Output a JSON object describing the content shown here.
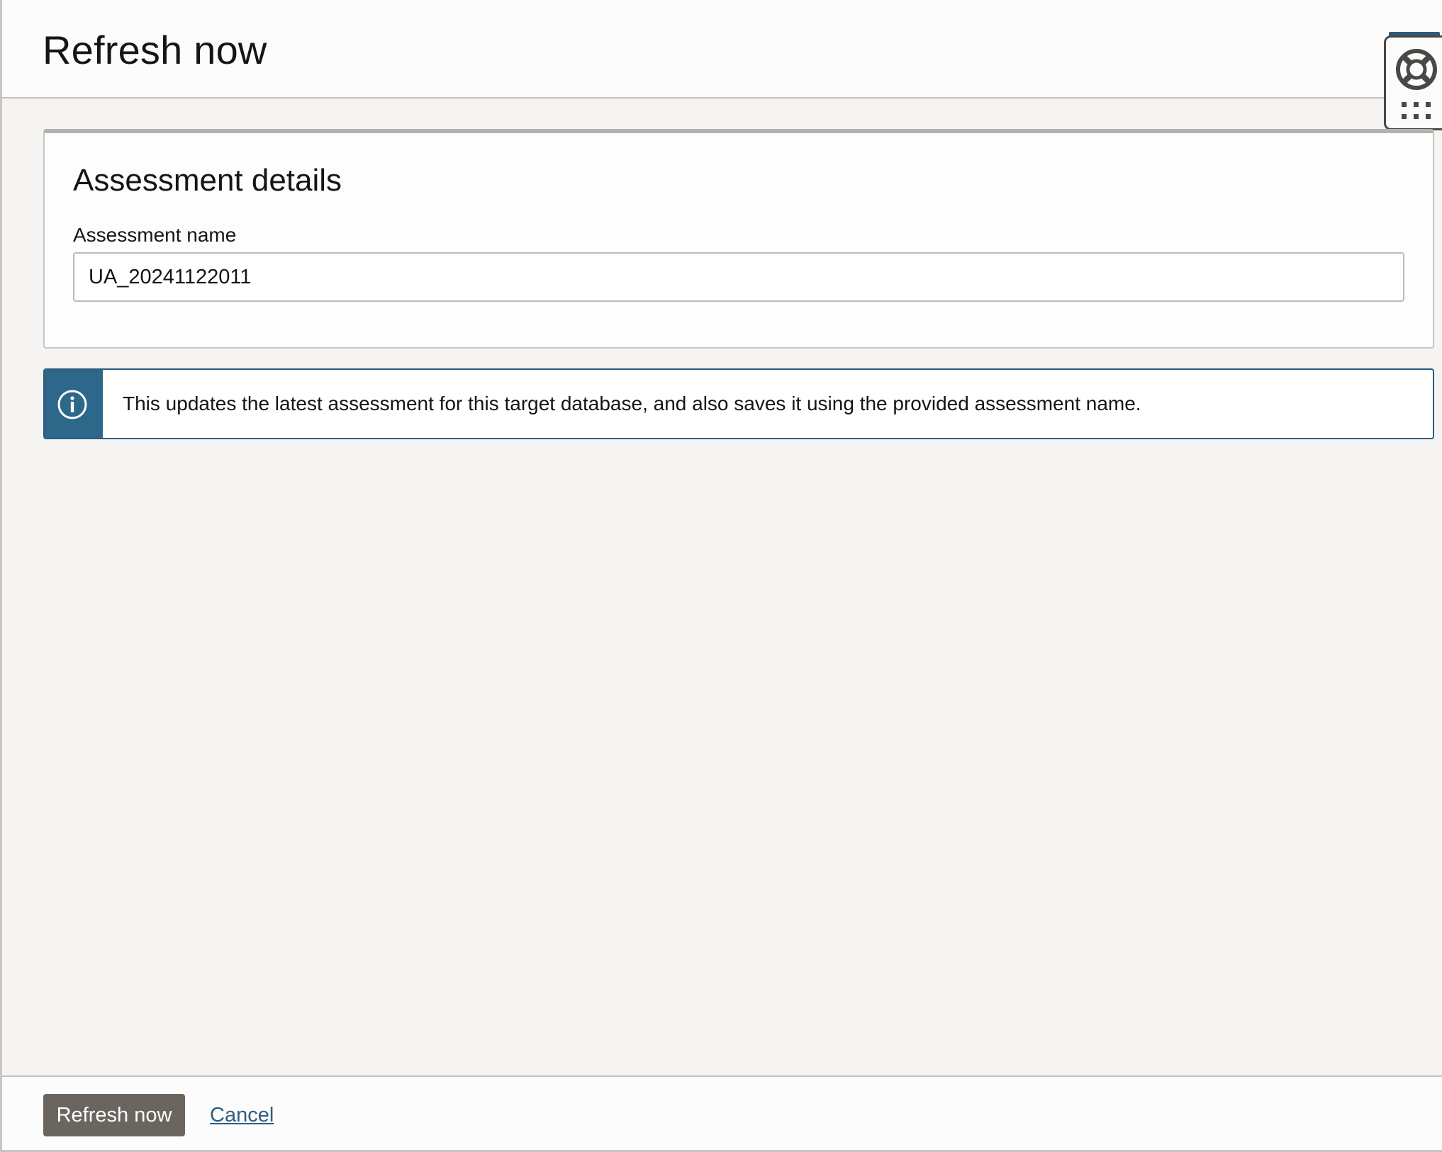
{
  "header": {
    "title": "Refresh now"
  },
  "helper": {
    "icons": [
      "lifebuoy-icon",
      "grid-icon"
    ]
  },
  "card": {
    "title": "Assessment details",
    "field": {
      "label": "Assessment name",
      "value": "UA_20241122011",
      "placeholder": ""
    }
  },
  "info": {
    "icon": "info-icon",
    "message": "This updates the latest assessment for this target database, and also saves it using the provided assessment name."
  },
  "footer": {
    "primary_label": "Refresh now",
    "cancel_label": "Cancel"
  },
  "colors": {
    "info_accent": "#2d6789",
    "primary_button": "#6b6560",
    "link": "#2e5e80"
  }
}
